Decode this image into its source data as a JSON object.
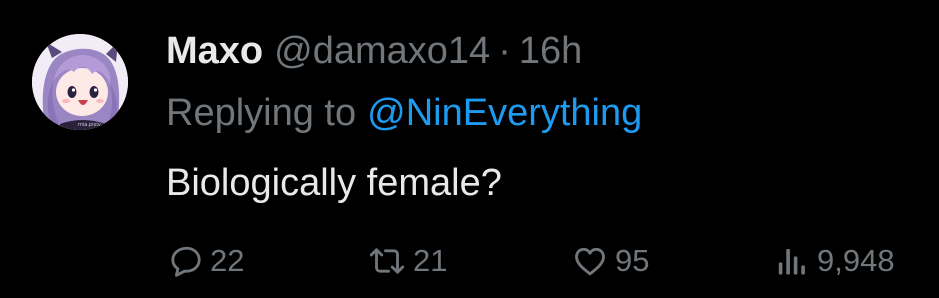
{
  "tweet": {
    "display_name": "Maxo",
    "handle": "@damaxo14",
    "separator": "·",
    "time": "16h",
    "replying_prefix": "Replying to",
    "replying_handle": "@NinEverything",
    "text": "Biologically female?",
    "avatar_watermark": "mia.pixiv",
    "colors": {
      "background": "#000000",
      "primary_text": "#e7e9ea",
      "secondary_text": "#71767b",
      "link": "#1d9bf0"
    }
  },
  "actions": {
    "reply": {
      "icon": "reply-bubble-icon",
      "count": "22"
    },
    "retweet": {
      "icon": "retweet-icon",
      "count": "21"
    },
    "like": {
      "icon": "heart-icon",
      "count": "95"
    },
    "views": {
      "icon": "views-chart-icon",
      "count": "9,948"
    }
  }
}
